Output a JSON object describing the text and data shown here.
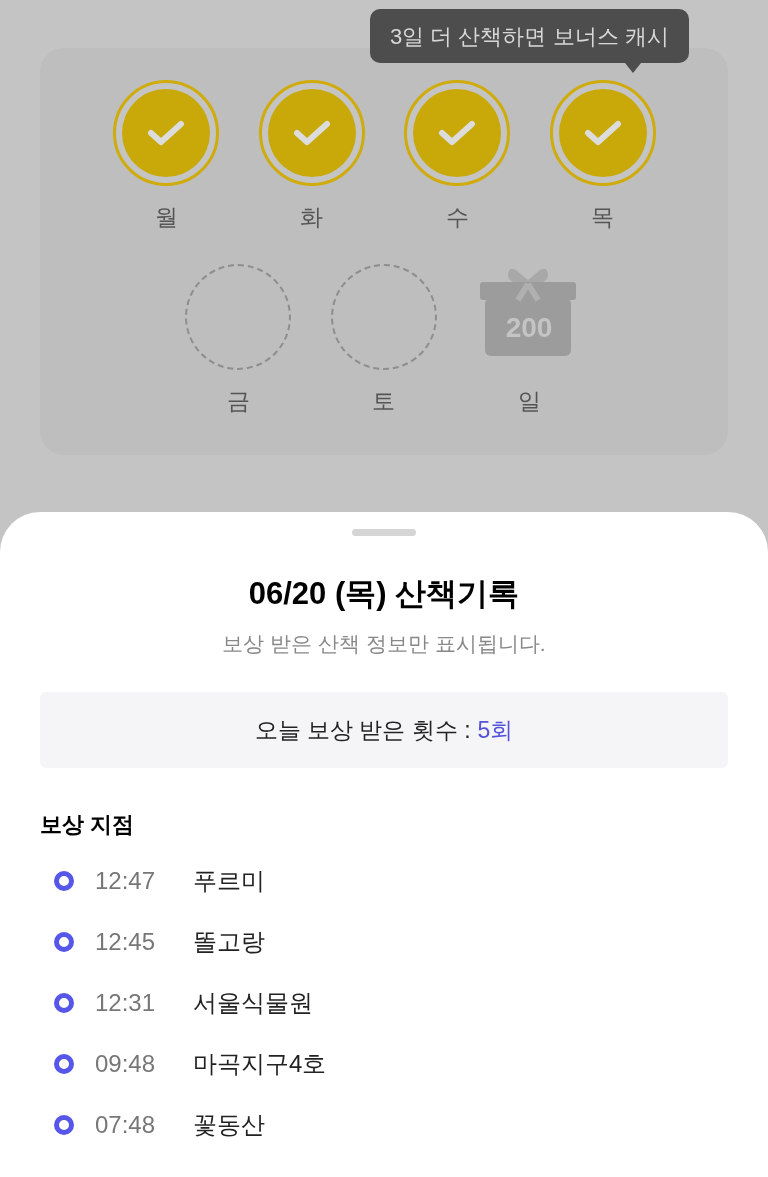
{
  "tooltip": "3일 더 산책하면 보너스 캐시",
  "days": [
    {
      "label": "월",
      "kind": "done"
    },
    {
      "label": "화",
      "kind": "done"
    },
    {
      "label": "수",
      "kind": "done"
    },
    {
      "label": "목",
      "kind": "done"
    },
    {
      "label": "금",
      "kind": "empty"
    },
    {
      "label": "토",
      "kind": "empty"
    },
    {
      "label": "일",
      "kind": "gift",
      "amount": "200"
    }
  ],
  "sheet": {
    "title": "06/20 (목) 산책기록",
    "subtitle": "보상 받은 산책 정보만 표시됩니다.",
    "count_label": "오늘 보상 받은 횟수 :",
    "count_value": "5회",
    "section_title": "보상 지점",
    "points": [
      {
        "time": "12:47",
        "place": "푸르미"
      },
      {
        "time": "12:45",
        "place": "똘고랑"
      },
      {
        "time": "12:31",
        "place": "서울식물원"
      },
      {
        "time": "09:48",
        "place": "마곡지구4호"
      },
      {
        "time": "07:48",
        "place": "꽃동산"
      }
    ]
  }
}
